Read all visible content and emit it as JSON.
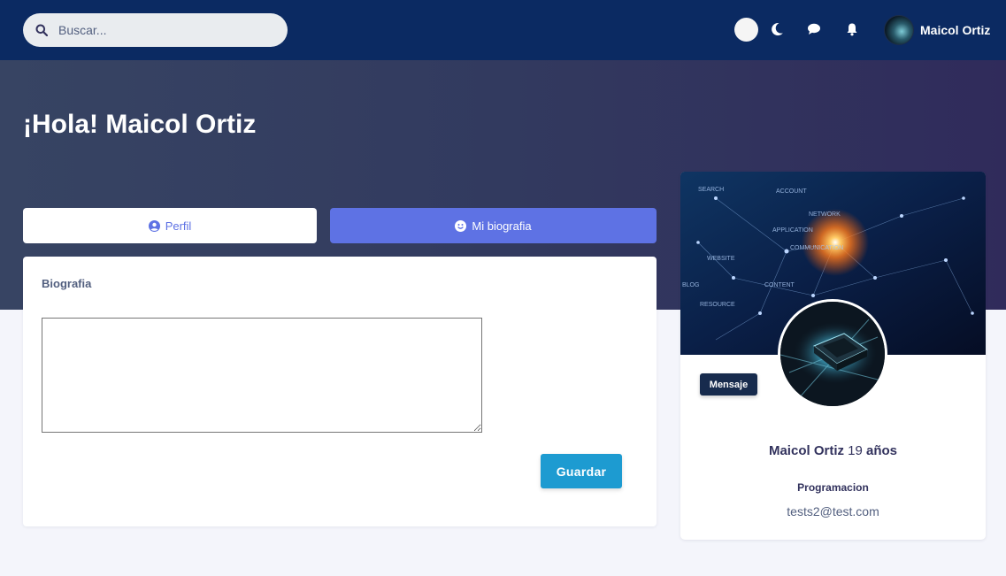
{
  "search": {
    "placeholder": "Buscar..."
  },
  "header": {
    "user_name": "Maicol Ortiz"
  },
  "hero": {
    "greeting": "¡Hola! Maicol Ortiz"
  },
  "tabs": [
    {
      "label": "Perfil",
      "icon": "user-circle-icon",
      "active": false
    },
    {
      "label": "Mi biografia",
      "icon": "smile-icon",
      "active": true
    }
  ],
  "bio_card": {
    "title": "Biografia",
    "textarea_value": "",
    "save_label": "Guardar"
  },
  "profile_card": {
    "message_label": "Mensaje",
    "name": "Maicol Ortiz",
    "age_number": "19",
    "age_unit": "años",
    "role": "Programacion",
    "email": "tests2@test.com",
    "cover_words": [
      "SEARCH",
      "ACCOUNT",
      "NETWORK",
      "APPLICATION",
      "COMMUNICATION",
      "WEBSITE",
      "CONTENT",
      "RESOURCE",
      "BLOG"
    ]
  },
  "colors": {
    "topbar": "#0b2a62",
    "accent": "#5e72e4",
    "save_button": "#1d9bd1",
    "message_button": "#172b4d"
  }
}
